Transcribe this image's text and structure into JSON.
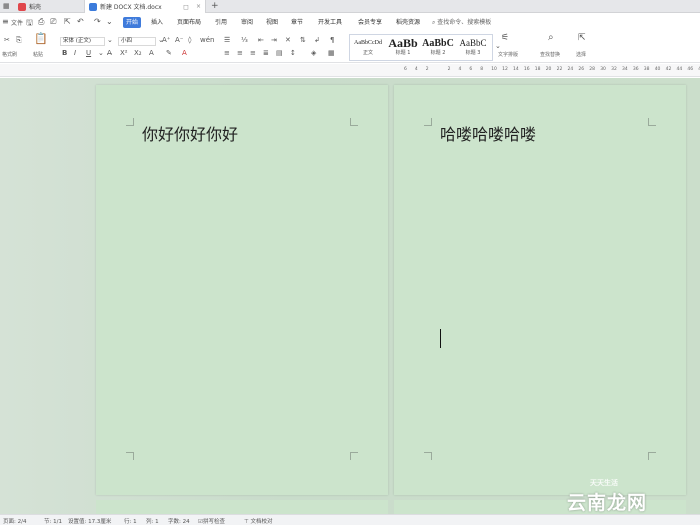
{
  "tabs": {
    "home_label": "稻壳",
    "doc_label": "新建 DOCX 文档.docx",
    "new_tab": "+"
  },
  "menu": {
    "file_label": "文件",
    "items": [
      "开始",
      "插入",
      "页面布局",
      "引用",
      "审阅",
      "视图",
      "章节",
      "开发工具",
      "会员专享",
      "稻壳资源"
    ],
    "active_index": 0,
    "search_label": "查找命令、搜索模板"
  },
  "ribbon": {
    "paste_label": "粘贴",
    "format_painter_label": "格式刷",
    "font_name": "宋体 (正文)",
    "font_size": "小四",
    "styles": [
      {
        "sample": "AaBbCcDd",
        "name": "正文"
      },
      {
        "sample": "AaBb",
        "name": "标题 1"
      },
      {
        "sample": "AaBbC",
        "name": "标题 2"
      },
      {
        "sample": "AaBbC",
        "name": "标题 3"
      }
    ],
    "text_tools_label": "文字排版",
    "find_replace_label": "查找替换",
    "select_label": "选择"
  },
  "ruler": {
    "numbers": [
      "6",
      "4",
      "2",
      "",
      "2",
      "4",
      "6",
      "8",
      "10",
      "12",
      "14",
      "16",
      "18",
      "20",
      "22",
      "24",
      "26",
      "28",
      "30",
      "32",
      "34",
      "36",
      "38",
      "40",
      "42",
      "44",
      "46",
      "48"
    ]
  },
  "document": {
    "left_page_text": "你好你好你好",
    "right_page_text": "哈喽哈喽哈喽"
  },
  "status": {
    "page": "页面: 2/4",
    "section": "节: 1/1",
    "setting": "设置值: 17.3厘米",
    "row": "行: 1",
    "col": "列: 1",
    "word_count": "字数: 24",
    "spell_check": "拼写检查",
    "doc_check": "文档校对"
  },
  "watermark": {
    "main": "云南龙网",
    "small": "天天生活"
  },
  "colors": {
    "accent": "#3f7bdb",
    "page_bg": "#cce4cc",
    "canvas_bg": "#c9dccb"
  }
}
